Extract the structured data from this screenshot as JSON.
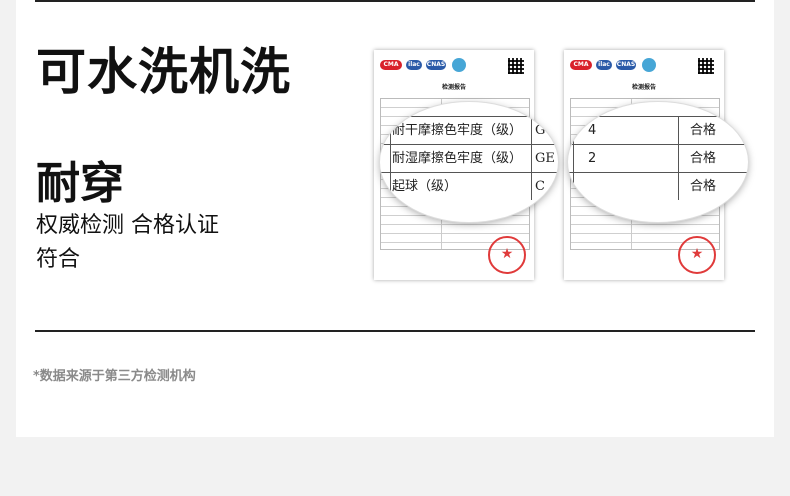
{
  "headline": "可水洗机洗",
  "subhead": "耐穿",
  "line1": "权威检测 合格认证",
  "line2": "符合",
  "note": "*数据来源于第三方检测机构",
  "report": {
    "title": "检测报告",
    "logos": [
      "CMA",
      "ilac",
      "CNAS"
    ]
  },
  "magnifier_left": {
    "rows": [
      {
        "label": "耐干摩擦色牢度（级）",
        "std": "G"
      },
      {
        "label": "耐湿摩擦色牢度（级）",
        "std": "GE"
      },
      {
        "label": "起球（级）",
        "std": "C"
      }
    ]
  },
  "magnifier_right": {
    "rows": [
      {
        "value": "4",
        "result": "合格"
      },
      {
        "value": "2",
        "result": "合格"
      },
      {
        "value": "",
        "result": "合格"
      }
    ]
  },
  "colors": {
    "text": "#111111",
    "note": "#8a8a8a",
    "stamp": "#e03a3a",
    "background": "#f2f2f2"
  }
}
